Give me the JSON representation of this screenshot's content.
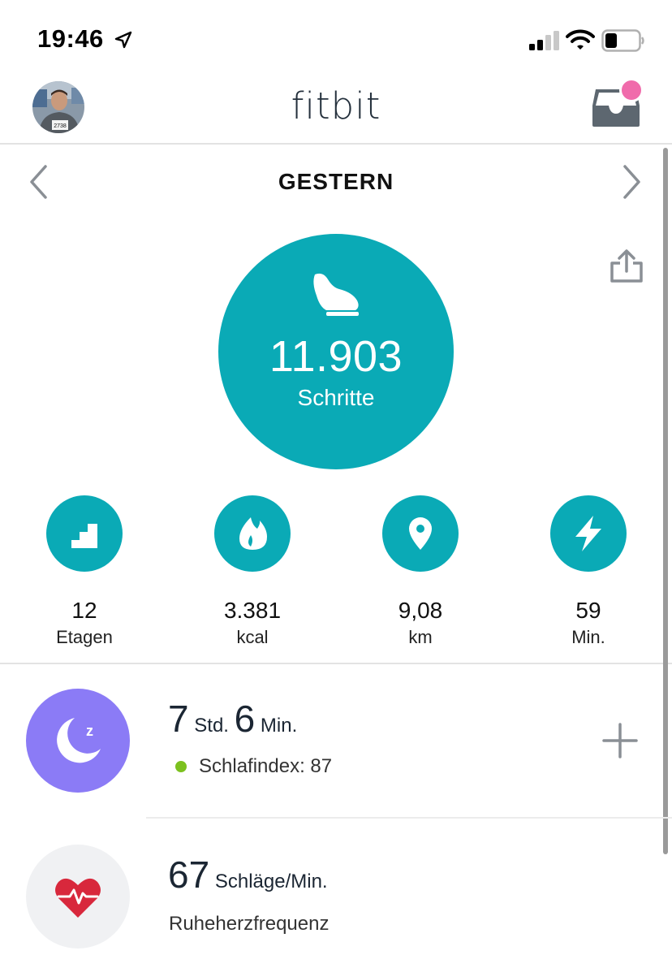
{
  "status_bar": {
    "time": "19:46"
  },
  "header": {
    "title": "fitbit",
    "avatar_bib": "2738"
  },
  "date_nav": {
    "label": "GESTERN"
  },
  "steps": {
    "value": "11.903",
    "label": "Schritte"
  },
  "stats": [
    {
      "value": "12",
      "unit": "Etagen",
      "icon": "stairs-icon"
    },
    {
      "value": "3.381",
      "unit": "kcal",
      "icon": "flame-icon"
    },
    {
      "value": "9,08",
      "unit": "km",
      "icon": "location-pin-icon"
    },
    {
      "value": "59",
      "unit": "Min.",
      "icon": "lightning-icon"
    }
  ],
  "sleep": {
    "hours": "7",
    "hours_unit": "Std.",
    "minutes": "6",
    "minutes_unit": "Min.",
    "score_label": "Schlafindex: 87"
  },
  "heart": {
    "value": "67",
    "unit": "Schläge/Min.",
    "label": "Ruheherzfrequenz"
  },
  "colors": {
    "teal": "#0aaab6",
    "sleep_purple": "#8b7bf6",
    "heart_red": "#d8283c",
    "notification_pink": "#f06bab",
    "sleep_score_green": "#7cc11f"
  }
}
